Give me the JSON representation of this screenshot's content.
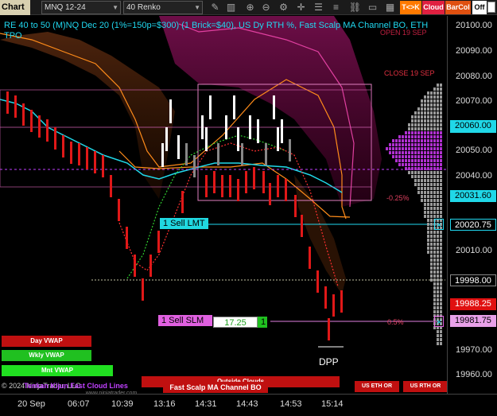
{
  "toolbar": {
    "chart_tab": "Chart",
    "instrument": "MNQ 12-24",
    "bar_type": "40 Renko",
    "icons": [
      "pencil-icon",
      "bars-icon",
      "zoom-in-icon",
      "zoom-out-icon",
      "settings-icon",
      "crosshair-icon",
      "menu-icon",
      "list-icon",
      "link-icon",
      "window-icon",
      "tile-icon"
    ],
    "tk_label": "T<>K",
    "cloud_label": "Cloud",
    "barcol_label": "BarCol",
    "off_label": "Off",
    "colors": {
      "tk": "#ff7a00",
      "cloud": "#e02040",
      "barcol": "#e05010",
      "off": "#ffffff"
    }
  },
  "chart": {
    "header": "RE 40 to 50 (M)NQ Dec 20 (1%=150p=$300) (1 Brick=$40), US Dy RTH %, Fast Scalp MA Channel BO, ETH TPO",
    "open_label": "OPEN 19 SEP",
    "close_label": "CLOSE 19 SEP",
    "pct_neg": "-0.25%",
    "pct_pos": "0.5%",
    "dpp_label": "DPP",
    "copyright": "© 2024 NinjaTrader, LLC",
    "kijun_label": "Tenkan Kijun Fast Cloud Lines",
    "outside_clouds": "Outside Clouds",
    "fast_scalp_btn": "Fast Scalp MA Channel BO",
    "us_eth_or": "US ETH OR",
    "us_rth_or": "US RTH OR",
    "ninja_url": "www.ninjatrader.com"
  },
  "orders": {
    "sell_lmt": "1 Sell LMT",
    "sell_slm": "1 Sell SLM",
    "pnl": "17.25",
    "qty": "1",
    "close_x": "✕"
  },
  "vwap": {
    "day": "Day VWAP",
    "wkly": "Wkly VWAP",
    "mnt": "Mnt VWAP"
  },
  "price_axis": {
    "ticks": [
      "20100.00",
      "20090.00",
      "20080.00",
      "20070.00",
      "20060.00",
      "20050.00",
      "20040.00",
      "20030.00",
      "20020.00",
      "20010.00",
      "20000.00",
      "19990.00",
      "19980.00",
      "19970.00",
      "19960.00"
    ],
    "current_cyan": "20031.60",
    "lmt_price": "20020.75",
    "dotted_price": "19998.00",
    "last_price": "19988.25",
    "slm_price": "19981.75"
  },
  "time_axis": [
    "20 Sep",
    "06:07",
    "10:39",
    "13:16",
    "14:31",
    "14:43",
    "14:53",
    "15:14"
  ]
}
